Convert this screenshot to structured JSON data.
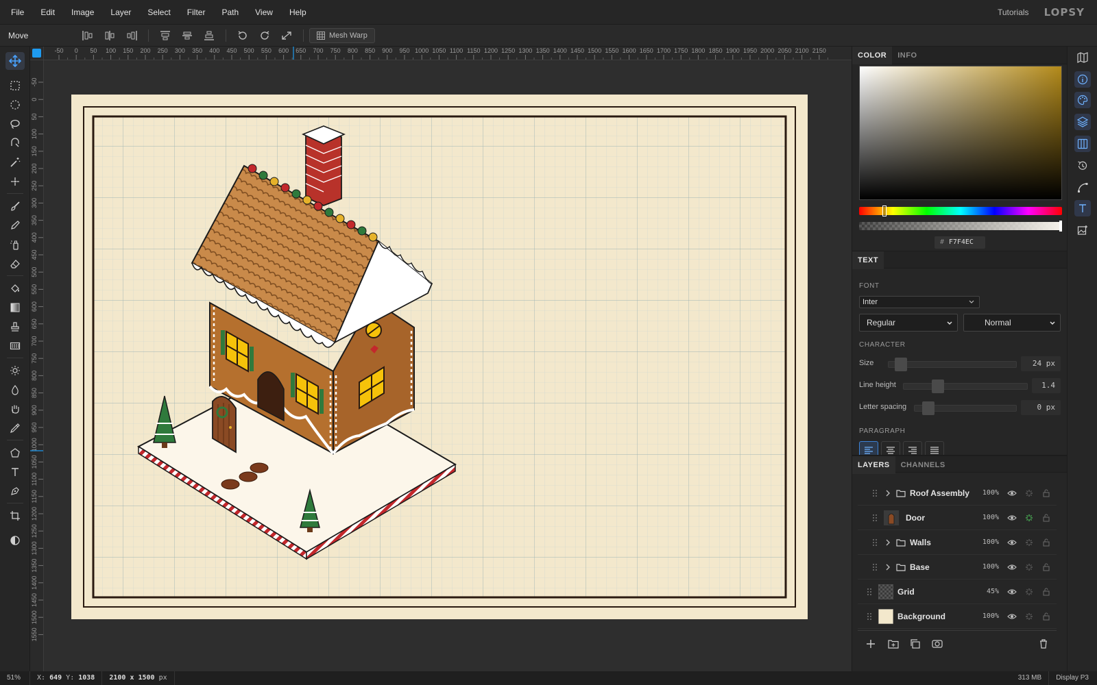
{
  "menubar": {
    "items": [
      "File",
      "Edit",
      "Image",
      "Layer",
      "Select",
      "Filter",
      "Path",
      "View",
      "Help"
    ],
    "tutorials": "Tutorials",
    "logo": "LOPSY"
  },
  "optionsbar": {
    "tool_name": "Move",
    "mesh_warp_label": "Mesh Warp"
  },
  "rulers": {
    "top_labels": [
      "-50",
      "0",
      "50",
      "100",
      "150",
      "200",
      "250",
      "300",
      "350",
      "400",
      "450",
      "500",
      "550",
      "600",
      "650",
      "700",
      "750",
      "800",
      "850",
      "900",
      "950",
      "1000",
      "1050",
      "1100",
      "1150",
      "1200",
      "1250",
      "1300",
      "1350",
      "1400",
      "1450",
      "1500",
      "1550",
      "1600",
      "1650",
      "1700",
      "1750",
      "1800",
      "1850",
      "1900",
      "1950",
      "2000",
      "2050",
      "2100",
      "2150"
    ],
    "left_labels": [
      "-50",
      "0",
      "50",
      "100",
      "150",
      "200",
      "250",
      "300",
      "350",
      "400",
      "450",
      "500",
      "550",
      "600",
      "650",
      "700",
      "750",
      "800",
      "850",
      "900",
      "950",
      "1000",
      "1050",
      "1100",
      "1150",
      "1200",
      "1250",
      "1300",
      "1350",
      "1400",
      "1450",
      "1500",
      "1550"
    ]
  },
  "color_panel": {
    "tabs": [
      "COLOR",
      "INFO"
    ],
    "hex_prefix": "#",
    "hex_value": "F7F4EC",
    "base_hue_color": "#b38a1a"
  },
  "text_panel": {
    "tab": "TEXT",
    "font_label": "FONT",
    "font_value": "Inter",
    "weight_options": [
      "Regular"
    ],
    "style_options": [
      "Normal"
    ],
    "character_label": "CHARACTER",
    "size_label": "Size",
    "size_value": "24 px",
    "line_height_label": "Line height",
    "line_height_value": "1.4",
    "letter_spacing_label": "Letter spacing",
    "letter_spacing_value": "0 px",
    "paragraph_label": "PARAGRAPH"
  },
  "layers_panel": {
    "tabs": [
      "LAYERS",
      "CHANNELS"
    ],
    "layers": [
      {
        "name": "Roof Assembly",
        "opacity": "100%",
        "type": "group"
      },
      {
        "name": "Door",
        "opacity": "100%",
        "type": "image"
      },
      {
        "name": "Walls",
        "opacity": "100%",
        "type": "group"
      },
      {
        "name": "Base",
        "opacity": "100%",
        "type": "group"
      },
      {
        "name": "Grid",
        "opacity": "45%",
        "type": "image"
      },
      {
        "name": "Background",
        "opacity": "100%",
        "type": "image"
      }
    ]
  },
  "statusbar": {
    "zoom": "51%",
    "x_label": "X:",
    "x_value": "649",
    "y_label": "Y:",
    "y_value": "1038",
    "doc_size": "2100 x 1500",
    "doc_unit": "px",
    "memory": "313 MB",
    "color_profile": "Display P3"
  },
  "colors": {
    "accent": "#1e9bf0",
    "canvas_paper": "#f3e8cc",
    "house_wall": "#b5702e",
    "roof": "#c98a4a",
    "chimney": "#b8322a",
    "tree": "#2f7a3c"
  }
}
